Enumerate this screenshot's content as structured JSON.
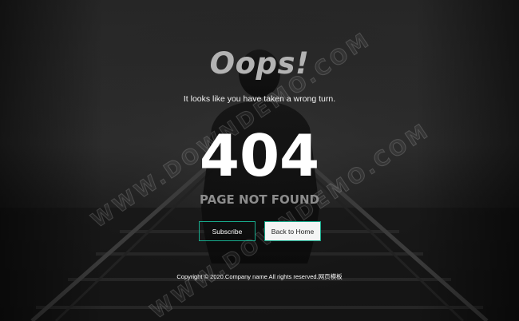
{
  "page": {
    "title": "Oops!",
    "subtitle": "It looks like you have taken a wrong turn.",
    "error_code": "404",
    "error_message": "PAGE NOT FOUND"
  },
  "actions": {
    "subscribe_label": "Subscribe",
    "home_label": "Back to Home"
  },
  "footer": {
    "copyright": "Copyright © 2020.Company name All rights reserved.网页模板"
  },
  "watermark": {
    "text_1": "WWW.DOWNDEMO.COM",
    "text_2": "WWW.DOWNDEMO.COM"
  },
  "colors": {
    "accent": "#17a98b",
    "background": "#1a1a1a",
    "title": "#b3b3b3",
    "muted": "#8c8c8c"
  }
}
